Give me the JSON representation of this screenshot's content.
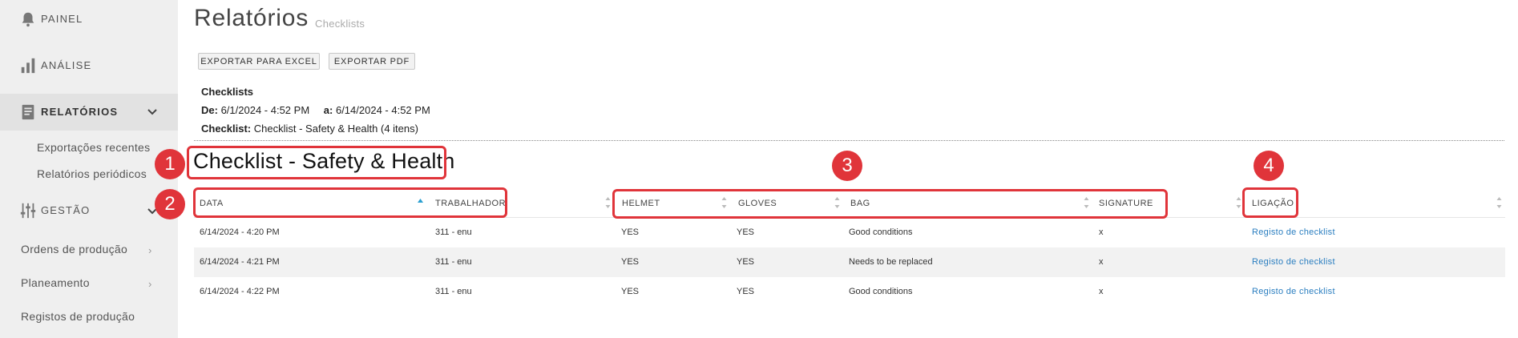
{
  "sidebar": {
    "items": [
      {
        "label": "PAINEL",
        "icon": "bell-icon"
      },
      {
        "label": "ANÁLISE",
        "icon": "bar-chart-icon"
      },
      {
        "label": "RELATÓRIOS",
        "icon": "report-icon"
      },
      {
        "label": "GESTÃO",
        "icon": "sliders-icon"
      }
    ],
    "reports_sub": [
      "Exportações recentes",
      "Relatórios periódicos"
    ],
    "management_sub": [
      "Ordens de produção",
      "Planeamento",
      "Registos de produção"
    ]
  },
  "header": {
    "title": "Relatórios",
    "subtitle": "Checklists"
  },
  "toolbar": {
    "export_excel": "EXPORTAR PARA EXCEL",
    "export_pdf": "EXPORTAR PDF"
  },
  "report_info": {
    "heading": "Checklists",
    "from_label": "De:",
    "from_value": "6/1/2024 - 4:52 PM",
    "to_label": "a:",
    "to_value": "6/14/2024 - 4:52 PM",
    "checklist_label": "Checklist:",
    "checklist_value": "Checklist - Safety & Health (4 itens)"
  },
  "checklist_title": "Checklist - Safety & Health",
  "table": {
    "columns": [
      "DATA",
      "TRABALHADOR",
      "HELMET",
      "GLOVES",
      "BAG",
      "SIGNATURE",
      "LIGAÇÃO"
    ],
    "rows": [
      [
        "6/14/2024 - 4:20 PM",
        "311 - enu",
        "YES",
        "YES",
        "Good conditions",
        "x",
        "Registo de checklist"
      ],
      [
        "6/14/2024 - 4:21 PM",
        "311 - enu",
        "YES",
        "YES",
        "Needs to be replaced",
        "x",
        "Registo de checklist"
      ],
      [
        "6/14/2024 - 4:22 PM",
        "311 - enu",
        "YES",
        "YES",
        "Good conditions",
        "x",
        "Registo de checklist"
      ]
    ]
  },
  "annotations": [
    "1",
    "2",
    "3",
    "4"
  ],
  "colors": {
    "annotation": "#e0343a",
    "link": "#2a7ec0",
    "sidebar": "#efefef"
  }
}
